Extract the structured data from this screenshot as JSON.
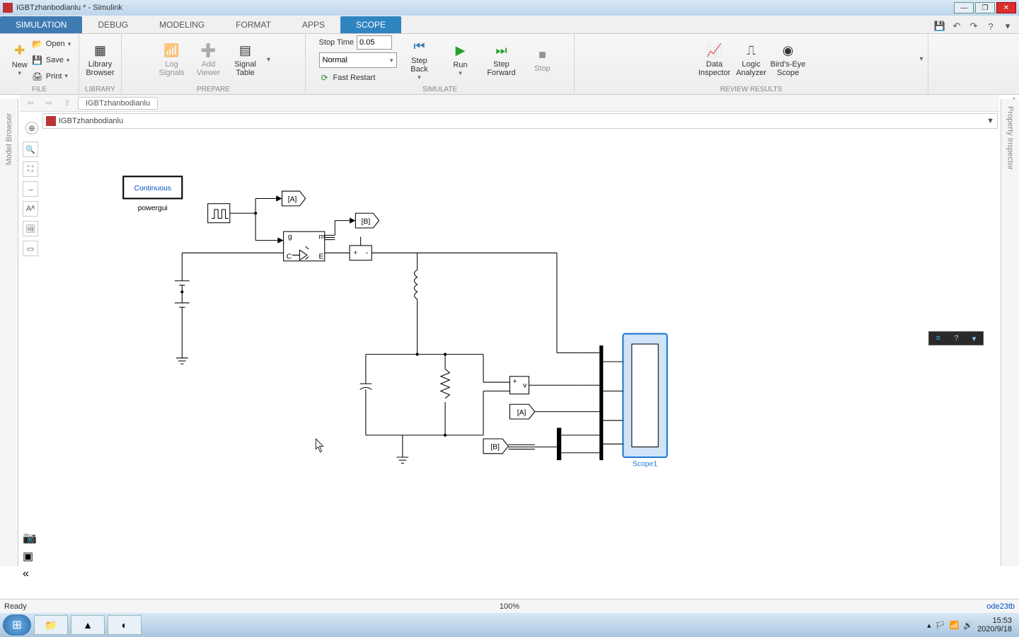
{
  "window": {
    "title": "IGBTzhanbodianlu * - Simulink",
    "model_browser": "Model Browser",
    "property_inspector": "Property Inspector"
  },
  "tabs": {
    "simulation": "SIMULATION",
    "debug": "DEBUG",
    "modeling": "MODELING",
    "format": "FORMAT",
    "apps": "APPS",
    "scope": "SCOPE"
  },
  "ribbon": {
    "file": {
      "new": "New",
      "open": "Open",
      "save": "Save",
      "print": "Print",
      "label": "FILE"
    },
    "library": {
      "btn": "Library\nBrowser",
      "label": "LIBRARY"
    },
    "prepare": {
      "log": "Log\nSignals",
      "add": "Add\nViewer",
      "signal": "Signal\nTable",
      "label": "PREPARE"
    },
    "simulate": {
      "stoptime_label": "Stop Time",
      "stoptime_value": "0.05",
      "mode": "Normal",
      "fastrestart": "Fast Restart",
      "stepback": "Step\nBack",
      "run": "Run",
      "stepfwd": "Step\nForward",
      "stop": "Stop",
      "label": "SIMULATE"
    },
    "review": {
      "datainsp": "Data\nInspector",
      "logic": "Logic\nAnalyzer",
      "birdseye": "Bird's-Eye\nScope",
      "label": "REVIEW RESULTS"
    }
  },
  "breadcrumb": {
    "tab": "IGBTzhanbodianlu",
    "path": "IGBTzhanbodianlu"
  },
  "canvas": {
    "powergui_mode": "Continuous",
    "powergui_label": "powergui",
    "goto_a": "[A]",
    "goto_b": "[B]",
    "from_a": "[A]",
    "from_b": "[B]",
    "scope_label": "Scope1",
    "igbt_ports": {
      "g": "g",
      "m": "m",
      "c": "C",
      "e": "E"
    },
    "vmeas": {
      "plus": "+",
      "v": "v"
    }
  },
  "status": {
    "ready": "Ready",
    "zoom": "100%",
    "solver": "ode23tb"
  },
  "taskbar": {
    "time": "15:53",
    "date": "2020/9/18"
  }
}
